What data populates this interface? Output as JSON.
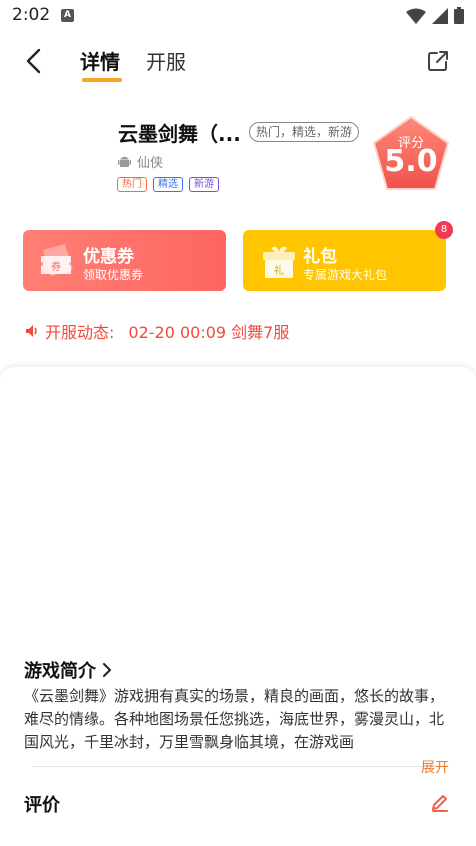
{
  "status_bar": {
    "time": "2:02",
    "notification_glyph": "A"
  },
  "nav": {
    "tabs": [
      "详情",
      "开服"
    ],
    "active_tab": "详情"
  },
  "game": {
    "title": "云墨剑舞（...",
    "tag_pill": "热门，精选，新游",
    "category": "仙侠",
    "chips": [
      "热门",
      "精选",
      "新游"
    ],
    "score_label": "评分",
    "score_value": "5.0"
  },
  "cards": {
    "coupon": {
      "title": "优惠券",
      "subtitle": "领取优惠券",
      "icon_text": "券"
    },
    "gift": {
      "title": "礼包",
      "subtitle": "专属游戏大礼包",
      "icon_text": "礼",
      "badge": "8"
    }
  },
  "opening": {
    "label": "开服动态:",
    "value": "02-20 00:09  剑舞7服"
  },
  "intro": {
    "title": "游戏简介",
    "text": "《云墨剑舞》游戏拥有真实的场景，精良的画面，悠长的故事，难尽的情缘。各种地图场景任您挑选，海底世界，雾漫灵山，北国风光，千里冰封，万里雪飘身临其境，在游戏画",
    "expand_label": "展开"
  },
  "review": {
    "title": "评价"
  },
  "colors": {
    "accent": "#f7a623",
    "coupon": "#fd6661",
    "gift": "#ffc500",
    "alert": "#f24a3a"
  },
  "icons": [
    "back-arrow-icon",
    "share-external-icon",
    "android-icon",
    "speaker-icon",
    "chevron-right-icon",
    "edit-pencil-icon",
    "ticket-icon",
    "gift-box-icon",
    "wifi-icon",
    "signal-icon",
    "battery-icon"
  ]
}
